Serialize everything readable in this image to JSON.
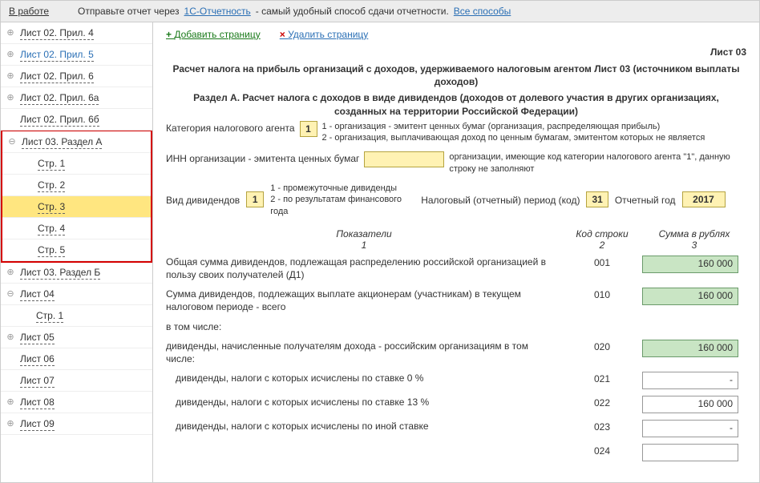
{
  "topbar": {
    "work": "В работе",
    "hint_pre": "Отправьте отчет через",
    "link1": "1С-Отчетность",
    "hint_post": "- самый удобный способ сдачи отчетности.",
    "link2": "Все способы"
  },
  "sidebar": {
    "items": [
      {
        "label": "Лист 02. Прил. 4",
        "lvl": 1,
        "exp": "⊕"
      },
      {
        "label": "Лист 02. Прил. 5",
        "lvl": 1,
        "exp": "⊕",
        "blue": true
      },
      {
        "label": "Лист 02. Прил. 6",
        "lvl": 1,
        "exp": "⊕"
      },
      {
        "label": "Лист 02. Прил. 6а",
        "lvl": 1,
        "exp": "⊕"
      },
      {
        "label": "Лист 02. Прил. 6б",
        "lvl": 1,
        "exp": ""
      },
      {
        "label": "Лист 03. Раздел А",
        "lvl": 1,
        "exp": "⊖",
        "red_start": true
      },
      {
        "label": "Стр. 1",
        "lvl": 2
      },
      {
        "label": "Стр. 2",
        "lvl": 2
      },
      {
        "label": "Стр. 3",
        "lvl": 2,
        "selected": true
      },
      {
        "label": "Стр. 4",
        "lvl": 2
      },
      {
        "label": "Стр. 5",
        "lvl": 2,
        "red_end": true
      },
      {
        "label": "Лист 03. Раздел Б",
        "lvl": 1,
        "exp": "⊕"
      },
      {
        "label": "Лист 04",
        "lvl": 1,
        "exp": "⊖"
      },
      {
        "label": "Стр. 1",
        "lvl": 2
      },
      {
        "label": "Лист 05",
        "lvl": 1,
        "exp": "⊕"
      },
      {
        "label": "Лист 06",
        "lvl": 1,
        "exp": ""
      },
      {
        "label": "Лист 07",
        "lvl": 1,
        "exp": ""
      },
      {
        "label": "Лист 08",
        "lvl": 1,
        "exp": "⊕"
      },
      {
        "label": "Лист 09",
        "lvl": 1,
        "exp": "⊕"
      }
    ]
  },
  "actions": {
    "add": "Добавить страницу",
    "del": "Удалить страницу"
  },
  "page_title": "Лист 03",
  "header1": "Расчет налога на прибыль организаций с доходов, удерживаемого налоговым агентом Лист 03 (источником выплаты доходов)",
  "header2": "Раздел А. Расчет налога с доходов в виде дивидендов (доходов от долевого участия в других организациях, созданных на территории Российской Федерации)",
  "cat": {
    "label": "Категория налогового агента",
    "value": "1",
    "hint": "1 - организация - эмитент ценных бумаг (организация, распределяющая прибыль)\n2 - организация, выплачивающая доход по ценным бумагам, эмитентом которых не является"
  },
  "inn": {
    "label": "ИНН организации - эмитента ценных бумаг",
    "value": "",
    "hint": "организации, имеющие код категории налогового агента \"1\", данную строку не заполняют"
  },
  "div": {
    "label": "Вид дивидендов",
    "value": "1",
    "hint": "1 - промежуточные дивиденды\n2 - по результатам финансового года",
    "period_label": "Налоговый (отчетный) период (код)",
    "period_value": "31",
    "year_label": "Отчетный год",
    "year_value": "2017"
  },
  "cols": {
    "c1": "Показатели",
    "c1n": "1",
    "c2": "Код строки",
    "c2n": "2",
    "c3": "Сумма в рублях",
    "c3n": "3"
  },
  "rows": [
    {
      "desc": "Общая сумма дивидендов, подлежащая распределению российской организацией в пользу своих получателей (Д1)",
      "code": "001",
      "amount": "160 000",
      "green": true
    },
    {
      "desc": "Сумма дивидендов, подлежащих выплате акционерам (участникам) в текущем налоговом периоде - всего",
      "code": "010",
      "amount": "160 000",
      "green": true
    },
    {
      "desc": "в том числе:",
      "code": "",
      "amount": null
    },
    {
      "desc": "дивиденды, начисленные получателям дохода - российским организациям в том числе:",
      "code": "020",
      "amount": "160 000",
      "green": true
    },
    {
      "desc": "дивиденды, налоги с которых исчислены по ставке 0 %",
      "code": "021",
      "amount": "-",
      "green": false,
      "indent": true
    },
    {
      "desc": "дивиденды, налоги с которых исчислены по ставке 13 %",
      "code": "022",
      "amount": "160 000",
      "green": false,
      "indent": true
    },
    {
      "desc": "дивиденды, налоги с которых исчислены по иной ставке",
      "code": "023",
      "amount": "-",
      "green": false,
      "indent": true
    },
    {
      "desc": "",
      "code": "024",
      "amount": "",
      "green": false,
      "indent": true
    }
  ]
}
